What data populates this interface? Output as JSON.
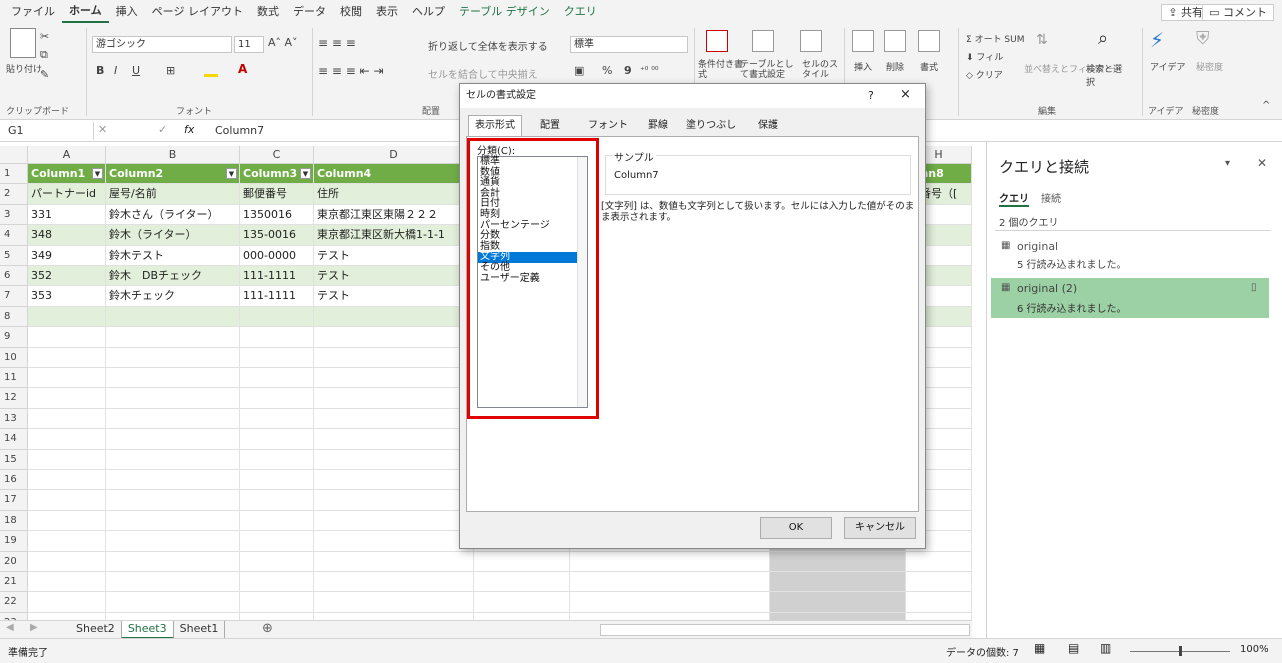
{
  "menu": {
    "items": [
      "ファイル",
      "ホーム",
      "挿入",
      "ページ レイアウト",
      "数式",
      "データ",
      "校閲",
      "表示",
      "ヘルプ",
      "テーブル デザイン",
      "クエリ"
    ],
    "share": "共有",
    "comment": "コメント"
  },
  "ribbon": {
    "paste": "貼り付け",
    "clipboard": "クリップボード",
    "font_name": "游ゴシック",
    "font_size": "11",
    "font_group": "フォント",
    "wrap_text": "折り返して全体を表示する",
    "merge": "セルを結合して中央揃え",
    "alignment_group": "配置",
    "number_format": "標準",
    "percent": "%",
    "comma": "9",
    "cond_format": "条件付き書式",
    "table_format": "テーブルとして書式設定",
    "cell_styles": "セルのスタイル",
    "insert": "挿入",
    "delete": "削除",
    "format": "書式",
    "autosum": "オート SUM",
    "fill": "フィル",
    "clear": "クリア",
    "sort_filter": "並べ替えとフィルター",
    "find_select": "検索と選択",
    "editing_group": "編集",
    "ideas": "アイデア",
    "ideas_group": "アイデア",
    "sensitivity": "秘密度",
    "sensitivity_group": "秘密度"
  },
  "formula": {
    "namebox": "G1",
    "fx": "fx",
    "value": "Column7"
  },
  "grid": {
    "columns": [
      "A",
      "B",
      "C",
      "D",
      "H"
    ],
    "headers": [
      "Column1",
      "Column2",
      "Column3",
      "Column4",
      "umn8"
    ],
    "rows": [
      [
        "パートナーid",
        "屋号/名前",
        "郵便番号",
        "住所",
        "話番号（["
      ],
      [
        "331",
        "鈴木さん（ライター）",
        "1350016",
        "東京都江東区東陽２２２",
        ""
      ],
      [
        "348",
        "鈴木（ライター）",
        "135-0016",
        "東京都江東区新大橋1-1-1",
        ""
      ],
      [
        "349",
        "鈴木テスト",
        "000-0000",
        "テスト",
        ""
      ],
      [
        "352",
        "鈴木　DBチェック",
        "111-1111",
        "テスト",
        ""
      ],
      [
        "353",
        "鈴木チェック",
        "111-1111",
        "テスト",
        ""
      ]
    ],
    "row_numbers": [
      "1",
      "2",
      "3",
      "4",
      "5",
      "6",
      "7",
      "8",
      "9",
      "10",
      "11",
      "12",
      "13",
      "14",
      "15",
      "16",
      "17",
      "18",
      "19",
      "20",
      "21",
      "22",
      "23"
    ]
  },
  "sheets": {
    "tabs": [
      "Sheet2",
      "Sheet3",
      "Sheet1"
    ],
    "add": "⊕"
  },
  "status": {
    "ready": "準備完了",
    "count": "データの個数: 7",
    "zoom": "100%"
  },
  "pane": {
    "title": "クエリと接続",
    "tab_query": "クエリ",
    "tab_conn": "接続",
    "count": "2 個のクエリ",
    "queries": [
      {
        "name": "original",
        "info": "5 行読み込まれました。"
      },
      {
        "name": "original (2)",
        "info": "6 行読み込まれました。"
      }
    ]
  },
  "dialog": {
    "title": "セルの書式設定",
    "help": "?",
    "close": "×",
    "tabs": [
      "表示形式",
      "配置",
      "フォント",
      "罫線",
      "塗りつぶし",
      "保護"
    ],
    "category_label": "分類(C):",
    "categories": [
      "標準",
      "数値",
      "通貨",
      "会計",
      "日付",
      "時刻",
      "パーセンテージ",
      "分数",
      "指数",
      "文字列",
      "その他",
      "ユーザー定義"
    ],
    "selected_category": "文字列",
    "sample_label": "サンプル",
    "sample_value": "Column7",
    "description": "[文字列] は、数値も文字列として扱います。セルには入力した値がそのまま表示されます。",
    "ok": "OK",
    "cancel": "キャンセル"
  }
}
